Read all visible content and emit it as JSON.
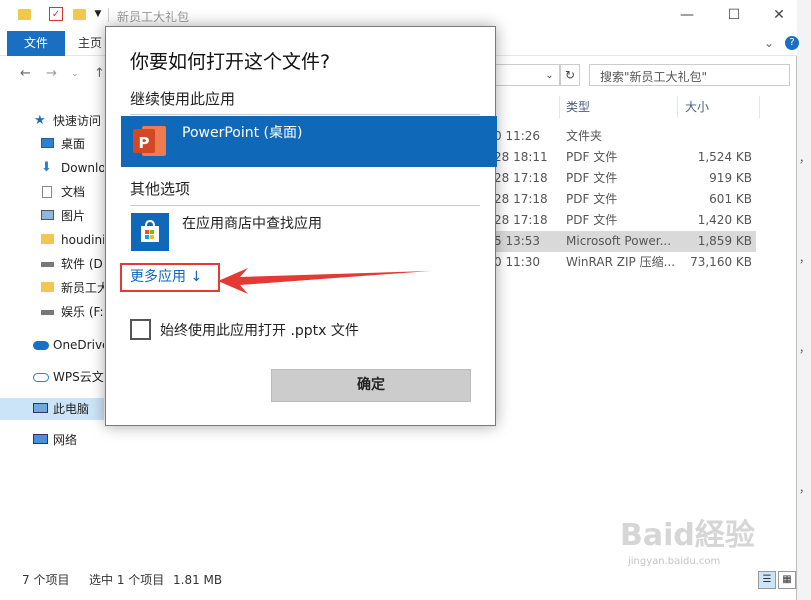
{
  "window": {
    "title": "新员工大礼包",
    "controls": {
      "minimize": "—",
      "maximize": "☐",
      "close": "✕"
    }
  },
  "ribbon": {
    "file_tab": "文件",
    "home_tab": "主页"
  },
  "search": {
    "placeholder": "搜索\"新员工大礼包\""
  },
  "sidebar": {
    "items": [
      {
        "label": "快速访问",
        "icon": "star-icon"
      },
      {
        "label": "桌面",
        "icon": "desktop-icon"
      },
      {
        "label": "Downlo",
        "icon": "download-icon"
      },
      {
        "label": "文档",
        "icon": "document-icon"
      },
      {
        "label": "图片",
        "icon": "picture-icon"
      },
      {
        "label": "houdini",
        "icon": "folder-icon"
      },
      {
        "label": "软件 (D:",
        "icon": "drive-icon"
      },
      {
        "label": "新员工大",
        "icon": "folder-icon"
      },
      {
        "label": "娱乐 (F:)",
        "icon": "drive-icon"
      },
      {
        "label": "OneDrive",
        "icon": "cloud-icon"
      },
      {
        "label": "WPS云文",
        "icon": "wps-cloud-icon"
      },
      {
        "label": "此电脑",
        "icon": "computer-icon"
      },
      {
        "label": "网络",
        "icon": "network-icon"
      }
    ]
  },
  "columns": {
    "type": "类型",
    "size": "大小"
  },
  "files": [
    {
      "date": "0 11:26",
      "type": "文件夹",
      "size": ""
    },
    {
      "date": "28 18:11",
      "type": "PDF 文件",
      "size": "1,524 KB"
    },
    {
      "date": "28 17:18",
      "type": "PDF 文件",
      "size": "919 KB"
    },
    {
      "date": "28 17:18",
      "type": "PDF 文件",
      "size": "601 KB"
    },
    {
      "date": "28 17:18",
      "type": "PDF 文件",
      "size": "1,420 KB"
    },
    {
      "date": "5 13:53",
      "type": "Microsoft Power...",
      "size": "1,859 KB"
    },
    {
      "date": "0 11:30",
      "type": "WinRAR ZIP 压缩...",
      "size": "73,160 KB"
    }
  ],
  "status": {
    "count": "7 个项目",
    "selection": "选中 1 个项目",
    "size": "1.81 MB"
  },
  "dialog": {
    "title": "你要如何打开这个文件?",
    "continue_label": "继续使用此应用",
    "primary_app": "PowerPoint (桌面)",
    "other_label": "其他选项",
    "store_app": "在应用商店中查找应用",
    "more_apps": "更多应用 ↓",
    "always_use": "始终使用此应用打开 .pptx 文件",
    "ok": "确定"
  },
  "watermark": {
    "text": "Baid経验",
    "sub": "jingyan.baidu.com"
  },
  "colors": {
    "accent": "#0f68b8",
    "file_tab": "#1a6fc3",
    "highlight_box": "#e53935",
    "powerpoint": "#d24726"
  }
}
